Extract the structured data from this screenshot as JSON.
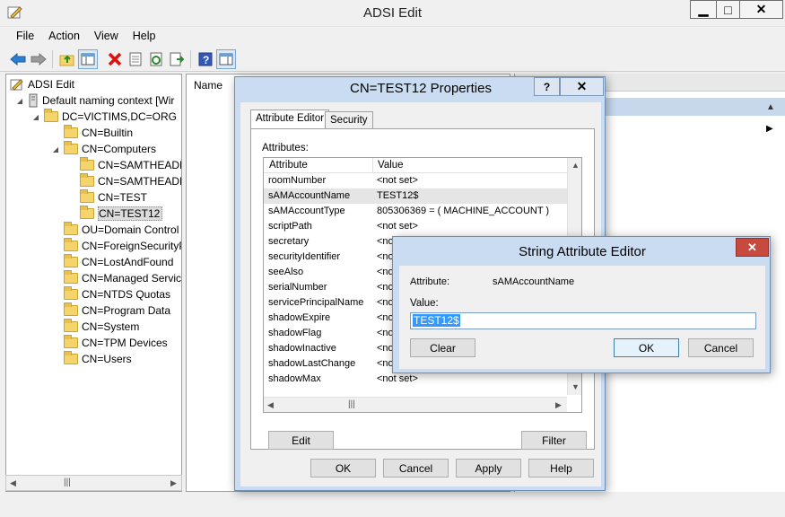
{
  "window": {
    "title": "ADSI Edit",
    "minimize": "▁",
    "maximize": "□",
    "close": "✕"
  },
  "menu": [
    "File",
    "Action",
    "View",
    "Help"
  ],
  "tree": {
    "root": "ADSI Edit",
    "context": "Default naming context [Wir",
    "domain": "DC=VICTIMS,DC=ORG",
    "items": [
      "CN=Builtin",
      "CN=Computers",
      "CN=SAMTHEADM",
      "CN=SAMTHEADM",
      "CN=TEST",
      "CN=TEST12",
      "OU=Domain Control",
      "CN=ForeignSecurityP",
      "CN=LostAndFound",
      "CN=Managed Service",
      "CN=NTDS Quotas",
      "CN=Program Data",
      "CN=System",
      "CN=TPM Devices",
      "CN=Users"
    ]
  },
  "list": {
    "name_header": "Name"
  },
  "properties": {
    "title": "CN=TEST12 Properties",
    "help": "?",
    "close": "✕",
    "tabs": [
      "Attribute Editor",
      "Security"
    ],
    "attributes_label": "Attributes:",
    "col_attribute": "Attribute",
    "col_value": "Value",
    "rows": [
      {
        "name": "roomNumber",
        "value": "<not set>"
      },
      {
        "name": "sAMAccountName",
        "value": "TEST12$"
      },
      {
        "name": "sAMAccountType",
        "value": "805306369 = ( MACHINE_ACCOUNT )"
      },
      {
        "name": "scriptPath",
        "value": "<not set>"
      },
      {
        "name": "secretary",
        "value": "<not"
      },
      {
        "name": "securityIdentifier",
        "value": "<not"
      },
      {
        "name": "seeAlso",
        "value": "<not"
      },
      {
        "name": "serialNumber",
        "value": "<not"
      },
      {
        "name": "servicePrincipalName",
        "value": "<not"
      },
      {
        "name": "shadowExpire",
        "value": "<not"
      },
      {
        "name": "shadowFlag",
        "value": "<not"
      },
      {
        "name": "shadowInactive",
        "value": "<not"
      },
      {
        "name": "shadowLastChange",
        "value": "<not"
      },
      {
        "name": "shadowMax",
        "value": "<not set>"
      }
    ],
    "edit": "Edit",
    "filter": "Filter",
    "ok": "OK",
    "cancel": "Cancel",
    "apply": "Apply",
    "help_btn": "Help"
  },
  "editor": {
    "title": "String Attribute Editor",
    "close": "✕",
    "attribute_label": "Attribute:",
    "attribute_value": "sAMAccountName",
    "value_label": "Value:",
    "value": "TEST12$",
    "clear": "Clear",
    "ok": "OK",
    "cancel": "Cancel"
  },
  "colors": {
    "dialog_frame": "#c9dcf1",
    "selection": "#3399ff",
    "close_red": "#c74a3f"
  }
}
